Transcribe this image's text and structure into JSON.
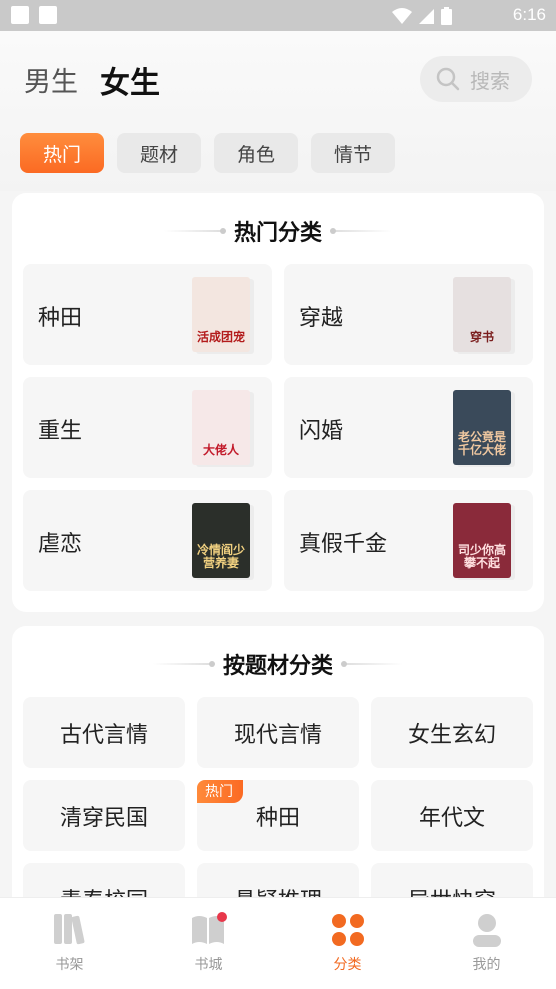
{
  "status_bar": {
    "time": "6:16"
  },
  "gender_tabs": {
    "male": "男生",
    "female": "女生"
  },
  "search": {
    "placeholder": "搜索"
  },
  "filter_tabs": [
    "热门",
    "题材",
    "角色",
    "情节"
  ],
  "hot_section": {
    "title": "热门分类",
    "items": [
      {
        "label": "种田",
        "cover_text": "活成团宠",
        "cover_bg": "#f3e6e0",
        "cover_fg": "#b31b1b"
      },
      {
        "label": "穿越",
        "cover_text": "穿书",
        "cover_bg": "#e6e0e0",
        "cover_fg": "#7a1d1d"
      },
      {
        "label": "重生",
        "cover_text": "大佬人",
        "cover_bg": "#f6e8e8",
        "cover_fg": "#c21b2b"
      },
      {
        "label": "闪婚",
        "cover_text": "老公竟是千亿大佬",
        "cover_bg": "#3a4a5a",
        "cover_fg": "#f0c8a0"
      },
      {
        "label": "虐恋",
        "cover_text": "冷情阎少营养妻",
        "cover_bg": "#2b2f2a",
        "cover_fg": "#f0d080"
      },
      {
        "label": "真假千金",
        "cover_text": "司少你高攀不起",
        "cover_bg": "#8a2a3a",
        "cover_fg": "#ffe0e0"
      }
    ]
  },
  "subject_section": {
    "title": "按题材分类",
    "badge": "热门",
    "items": [
      "古代言情",
      "现代言情",
      "女生玄幻",
      "清穿民国",
      "种田",
      "年代文",
      "青春校园",
      "悬疑推理",
      "异世快穿"
    ]
  },
  "bottom_nav": [
    "书架",
    "书城",
    "分类",
    "我的"
  ],
  "colors": {
    "accent": "#f26a21",
    "badge_dot": "#e8374a"
  }
}
